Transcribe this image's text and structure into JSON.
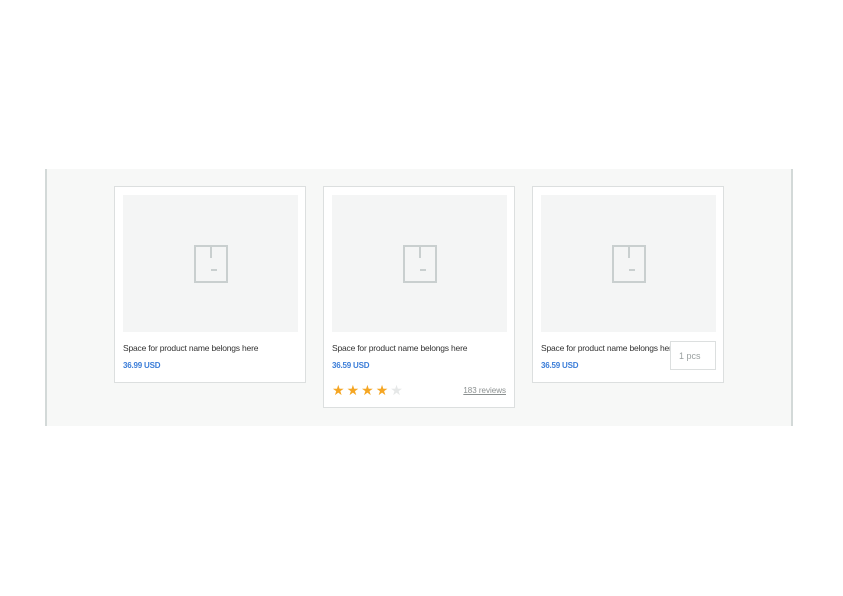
{
  "products": [
    {
      "name": "Space for product name belongs here",
      "price": "36.99 USD",
      "image_icon": "package-box-icon"
    },
    {
      "name": "Space for product name belongs here",
      "price": "36.59 USD",
      "image_icon": "package-box-icon",
      "rating": 4,
      "rating_max": 5,
      "reviews": "183 reviews"
    },
    {
      "name": "Space for product name belongs here",
      "price": "36.59 USD",
      "image_icon": "package-box-icon",
      "quantity_value": "1 pcs"
    }
  ],
  "colors": {
    "price": "#3b7dd8",
    "star_filled": "#f5a623",
    "star_empty": "#e6e8e8",
    "panel_background": "#f7f8f7"
  }
}
